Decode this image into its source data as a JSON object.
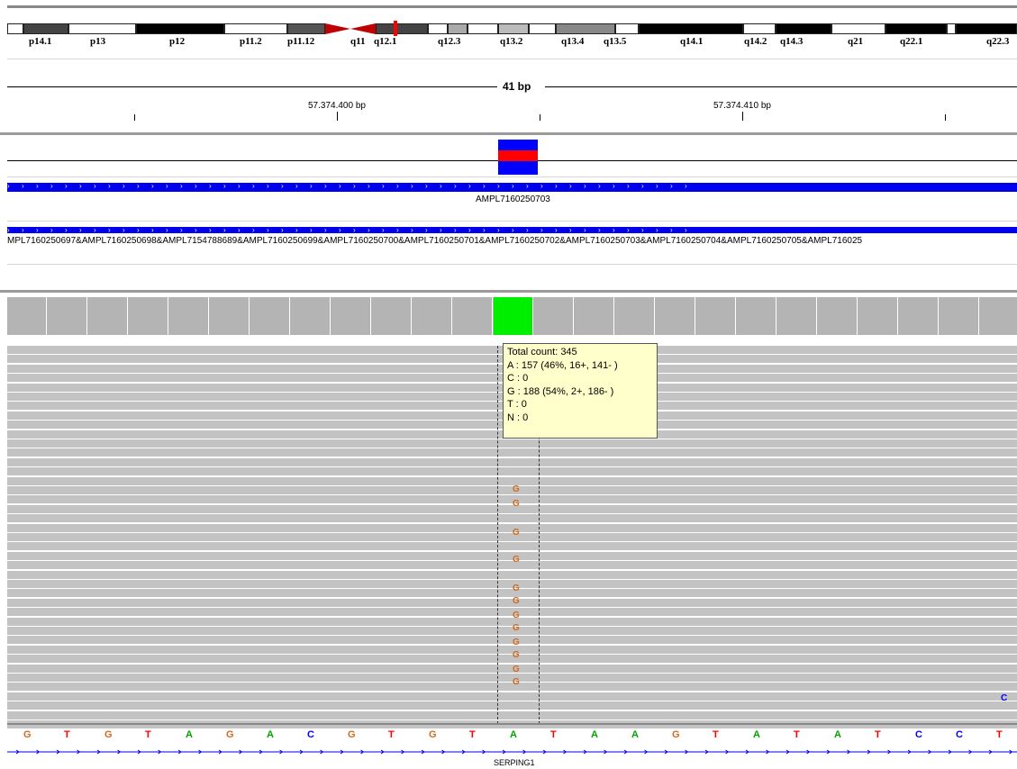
{
  "ideogram": {
    "bands": [
      "p14.1",
      "p13",
      "p12",
      "p11.2",
      "p11.12",
      "q11",
      "q12.1",
      "q12.3",
      "q13.2",
      "q13.4",
      "q13.5",
      "q14.1",
      "q14.2",
      "q14.3",
      "q21",
      "q22.1",
      "q22.3"
    ]
  },
  "ruler": {
    "span_label": "41 bp",
    "position_labels": [
      "57.374.400 bp",
      "57.374.410 bp"
    ]
  },
  "tracks": {
    "amplicon_label": "AMPL7160250703",
    "amplicon_list_label": "MPL7160250697&AMPL7160250698&AMPL7154788689&AMPL7160250699&AMPL7160250700&AMPL7160250701&AMPL7160250702&AMPL7160250703&AMPL7160250704&AMPL7160250705&AMPL716025"
  },
  "popup": {
    "total": "Total count: 345",
    "a": "A : 157 (46%, 16+, 141- )",
    "c": "C : 0",
    "g": "G : 188 (54%, 2+, 186- )",
    "t": "T : 0",
    "n": "N : 0"
  },
  "reads": {
    "mismatch_base": "G",
    "edge_base": "C"
  },
  "reference": {
    "bases": [
      "G",
      "T",
      "G",
      "T",
      "A",
      "G",
      "A",
      "C",
      "G",
      "T",
      "G",
      "T",
      "A",
      "T",
      "A",
      "A",
      "G",
      "T",
      "A",
      "T",
      "A",
      "T",
      "C",
      "C",
      "T"
    ],
    "gene_label": "SERPING1"
  },
  "colors": {
    "A": "#00a000",
    "C": "#0000ff",
    "G": "#d2691e",
    "T": "#ff0000",
    "coverage_highlight": "#00ee00",
    "feature": "#0000ee"
  }
}
